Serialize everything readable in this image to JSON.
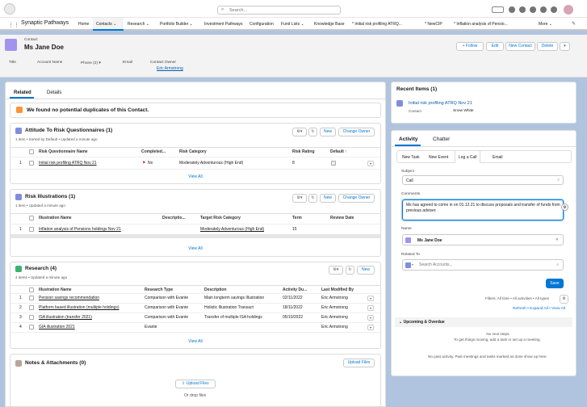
{
  "app": {
    "name": "Synaptic Pathways",
    "search_placeholder": "Search..."
  },
  "nav": {
    "items": [
      "Home",
      "Contacts",
      "Research",
      "Portfolio Builder",
      "Investment Pathways",
      "Configuration",
      "Fund Lists",
      "Knowledge Base",
      "* Initial risk profiling ATRQ...",
      "* NewCIP",
      "* Inflation analysis of Pensio...",
      "More"
    ]
  },
  "header": {
    "object": "Contact",
    "name": "Ms Jane Doe",
    "follow": "Follow",
    "edit": "Edit",
    "new_contact": "New Contact",
    "delete": "Delete",
    "fields": {
      "title": "Title",
      "account": "Account Name",
      "phone": "Phone (2)",
      "email": "Email",
      "owner": "Contact Owner",
      "owner_value": "Eric Armstrong"
    }
  },
  "tabs": {
    "related": "Related",
    "details": "Details"
  },
  "dup": {
    "text": "We found no potential duplicates of this Contact."
  },
  "atr": {
    "title": "Attitude To Risk Questionnaires (1)",
    "meta": "1 item • Sorted by Default • Updated a minute ago",
    "new": "New",
    "change_owner": "Change Owner",
    "cols": [
      "Risk Questionnaire Name",
      "Completed...",
      "Risk Category",
      "Risk Rating",
      "Default"
    ],
    "rows": [
      {
        "n": "1",
        "name": "Initial risk profiling ATRQ Nov 21",
        "completed": "No",
        "category": "Moderately Adventurous (High End)",
        "rating": "8"
      }
    ],
    "view_all": "View All"
  },
  "ill": {
    "title": "Risk Illustrations (1)",
    "meta": "1 item • Updated a minute ago",
    "new": "New",
    "change_owner": "Change Owner",
    "cols": [
      "Illustration Name",
      "Descriptio...",
      "Target Risk Category",
      "Term",
      "Review Date"
    ],
    "rows": [
      {
        "n": "1",
        "name": "Inflation analysis of Pensions holdings Nov 21",
        "category": "Moderately Adventurous (High End)",
        "term": "15"
      }
    ],
    "view_all": "View All"
  },
  "research": {
    "title": "Research (4)",
    "meta": "4 items • Updated a minute ago",
    "new": "New",
    "cols": [
      "Illustration Name",
      "Research Type",
      "Description",
      "Activity Du...",
      "Last Modified By"
    ],
    "rows": [
      {
        "n": "1",
        "name": "Pension savings recommendation",
        "type": "Comparison with Evante",
        "desc": "Main longterm savings Illustration",
        "date": "02/11/2022",
        "by": "Eric Armstrong"
      },
      {
        "n": "2",
        "name": "Platform based illustration (multiple holdings)",
        "type": "Comparison with Evante",
        "desc": "Holistic Illustration Transact",
        "date": "18/11/2022",
        "by": "Eric Armstrong"
      },
      {
        "n": "3",
        "name": "ISA illustration (transfer 2021)",
        "type": "Comparison with Evante",
        "desc": "Transfer of multiple ISA holdings",
        "date": "05/10/2022",
        "by": "Eric Armstrong"
      },
      {
        "n": "4",
        "name": "GIA illustration 2021",
        "type": "Evante",
        "desc": "",
        "date": "",
        "by": "Eric Armstrong"
      }
    ],
    "view_all": "View All"
  },
  "notes": {
    "title": "Notes & Attachments (0)",
    "upload": "Upload Files",
    "upload_btn": "Upload Files",
    "drop": "Or drop files"
  },
  "recent": {
    "title": "Recent Items (1)",
    "item": "Initial risk profiling ATRQ Nov 21",
    "contact_label": "Contact",
    "contact_value": "Snow White"
  },
  "activity": {
    "tab_activity": "Activity",
    "tab_chatter": "Chatter",
    "sub_tabs": [
      "New Task",
      "New Event",
      "Log a Call",
      "Email"
    ],
    "subject_label": "Subject",
    "subject_value": "Call",
    "comments_label": "Comments",
    "comments_value": "Ms has agreed to come in on 01.12.21 to discuss proposals and transfer of funds from previous adviser.",
    "name_label": "Name",
    "name_value": "Ms Jane Doe",
    "related_label": "Related To",
    "related_placeholder": "Search Accounts...",
    "save": "Save",
    "filters": "Filters: All time • All activities • All types",
    "refresh": "Refresh • Expand All • View All",
    "upcoming": "Upcoming & Overdue",
    "no_steps_1": "No next steps.",
    "no_steps_2": "To get things moving, add a task or set up a meeting.",
    "no_past": "No past activity. Past meetings and tasks marked as done show up here."
  }
}
